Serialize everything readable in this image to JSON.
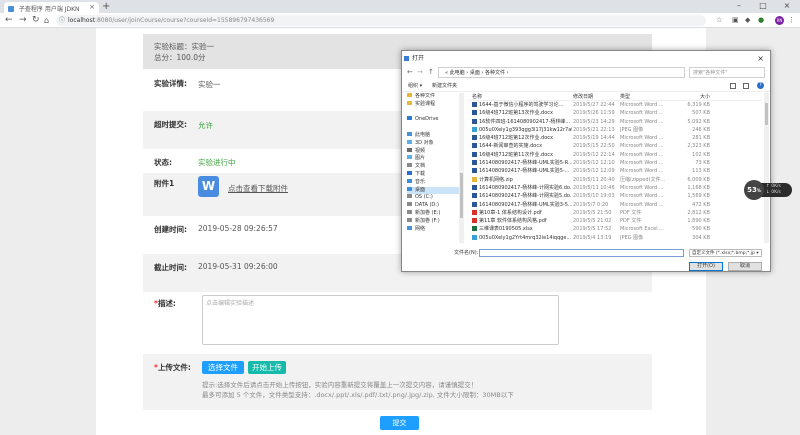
{
  "browser": {
    "tab_title": "子查程序 用户端 JDKN",
    "url_host": "localhost",
    "url_path": ":8080/user/joinCourse/course?courseId=155896797436569"
  },
  "page": {
    "header_title": "实验标题：实验一",
    "header_score": "总分：100.0分",
    "labels": {
      "detail": "实验详情:",
      "overdue": "超时提交:",
      "status": "状态:",
      "attachment": "附件1",
      "created": "创建时间:",
      "deadline": "截止时间:",
      "description": "描述:",
      "upload": "上传文件:"
    },
    "values": {
      "detail": "实验一",
      "overdue": "允许",
      "status": "实验进行中",
      "created": "2019-05-28 09:26:57",
      "deadline": "2019-05-31 09:26:00"
    },
    "download_link": "点击查看下载附件",
    "word_icon_letter": "W",
    "description_placeholder": "点击编辑实验描述",
    "select_file_label": "选择文件",
    "start_upload_label": "开始上传",
    "hint_line1": "提示:选择文件后请点击开始上传按钮，实验内容重新提交将覆盖上一次提交内容，请谨慎提交！",
    "hint_line2": "最多可添加 5 个文件，文件类型支持：.docx/.ppt/.xls/.pdf/.txt/.png/.jpg/.zip, 文件大小限制：30MB以下",
    "submit_label": "提交"
  },
  "dialog": {
    "title": "打开",
    "breadcrumb": "« 此电脑 › 桌面 › 各种文件 ›",
    "search_placeholder": "搜索\"各种文件\"",
    "organize_label": "组织 ▾",
    "new_folder_label": "新建文件夹",
    "nav_items": [
      {
        "label": "各种文件",
        "color": "#e8b63a"
      },
      {
        "label": "实验课程",
        "color": "#e8b63a"
      },
      {
        "label": "",
        "color": "#ffffff"
      },
      {
        "label": "OneDrive",
        "color": "#2b7cd3"
      },
      {
        "label": "",
        "color": "#ffffff"
      },
      {
        "label": "此电脑",
        "color": "#4a90d9"
      },
      {
        "label": "3D 对象",
        "color": "#5ab0e8"
      },
      {
        "label": "视频",
        "color": "#6a6a6a"
      },
      {
        "label": "图片",
        "color": "#5ab0e8"
      },
      {
        "label": "文档",
        "color": "#8a8a8a"
      },
      {
        "label": "下载",
        "color": "#2a6fcc"
      },
      {
        "label": "音乐",
        "color": "#3a8ee0"
      },
      {
        "label": "桌面",
        "color": "#3a8ee0"
      },
      {
        "label": "OS (C:)",
        "color": "#8a8a8a"
      },
      {
        "label": "DATA (D:)",
        "color": "#8a8a8a"
      },
      {
        "label": "新加卷 (E:)",
        "color": "#8a8a8a"
      },
      {
        "label": "新加卷 (F:)",
        "color": "#8a8a8a"
      },
      {
        "label": "网络",
        "color": "#4a90d9"
      }
    ],
    "columns": [
      "名称",
      "修改日期",
      "类型",
      "大小"
    ],
    "files": [
      {
        "icon": "word",
        "name": "1644-基于微信小程序的驾驶学习论...",
        "date": "2019/5/27 22:44",
        "type": "Microsoft Word ...",
        "size": "6,319 KB"
      },
      {
        "icon": "word",
        "name": "16级4班712班第13次作业.docx",
        "date": "2019/5/26 11:59",
        "type": "Microsoft Word ...",
        "size": "507 KB"
      },
      {
        "icon": "word",
        "name": "16软件四班-1614080902417-杨林峰...",
        "date": "2019/5/23 14:29",
        "type": "Microsoft Word ...",
        "size": "5,092 KB"
      },
      {
        "icon": "jpg",
        "name": "005u0Xely1g393qgg3l17j31kw12r7at...",
        "date": "2019/5/21 22:13",
        "type": "JPEG 图像",
        "size": "246 KB"
      },
      {
        "icon": "word",
        "name": "16级4班712班第12次作业.docx",
        "date": "2019/5/19 14:44",
        "type": "Microsoft Word ...",
        "size": "281 KB"
      },
      {
        "icon": "word",
        "name": "1644-新闻审查的实施.docx",
        "date": "2019/5/15 22:50",
        "type": "Microsoft Word ...",
        "size": "2,323 KB"
      },
      {
        "icon": "word",
        "name": "16级4班712班第11次作业.docx",
        "date": "2019/5/12 22:14",
        "type": "Microsoft Word ...",
        "size": "102 KB"
      },
      {
        "icon": "word",
        "name": "1614080902417-杨林峰-UML实验5-R...",
        "date": "2019/5/12 12:10",
        "type": "Microsoft Word ...",
        "size": "73 KB"
      },
      {
        "icon": "word",
        "name": "1614080902417-杨林峰-UML实验5-...",
        "date": "2019/5/12 12:09",
        "type": "Microsoft Word ...",
        "size": "113 KB"
      },
      {
        "icon": "zip",
        "name": "计算机网络.zip",
        "date": "2019/5/11 20:40",
        "type": "压缩(zipped)文件...",
        "size": "6,009 KB"
      },
      {
        "icon": "word",
        "name": "1614080902417-杨林峰-计网实验6.do...",
        "date": "2019/5/11 10:46",
        "type": "Microsoft Word ...",
        "size": "1,168 KB"
      },
      {
        "icon": "word",
        "name": "1614080902417-杨林峰-计网实验5.do...",
        "date": "2019/5/10 19:03",
        "type": "Microsoft Word ...",
        "size": "1,569 KB"
      },
      {
        "icon": "word",
        "name": "1614080902417-杨林峰-UML实验3-5...",
        "date": "2019/5/7 0:20",
        "type": "Microsoft Word ...",
        "size": "472 KB"
      },
      {
        "icon": "pdf",
        "name": "第10章-1 体系结构设计.pdf",
        "date": "2019/5/5 21:50",
        "type": "PDF 文件",
        "size": "2,812 KB"
      },
      {
        "icon": "pdf",
        "name": "第11章 软件体系结构风格.pdf",
        "date": "2019/5/5 21:02",
        "type": "PDF 文件",
        "size": "1,890 KB"
      },
      {
        "icon": "xls",
        "name": "三维课表0190505.xlsx",
        "date": "2019/5/5 17:52",
        "type": "Microsoft Excel ...",
        "size": "590 KB"
      },
      {
        "icon": "jpg",
        "name": "005u0Xely1g2Yrt4mrq32ie14iqqge...",
        "date": "2019/5/4 13:19",
        "type": "JPEG 图像",
        "size": "304 KB"
      }
    ],
    "filename_label": "文件名(N):",
    "filetype_value": "自定义文件 (*.xlsx;*.bmp;*.jp ▾",
    "open_label": "打开(O)",
    "cancel_label": "取消"
  },
  "speed_widget": {
    "value": "53",
    "unit": "%",
    "up": "↑ 0K/s",
    "down": "↓ 0K/s"
  }
}
